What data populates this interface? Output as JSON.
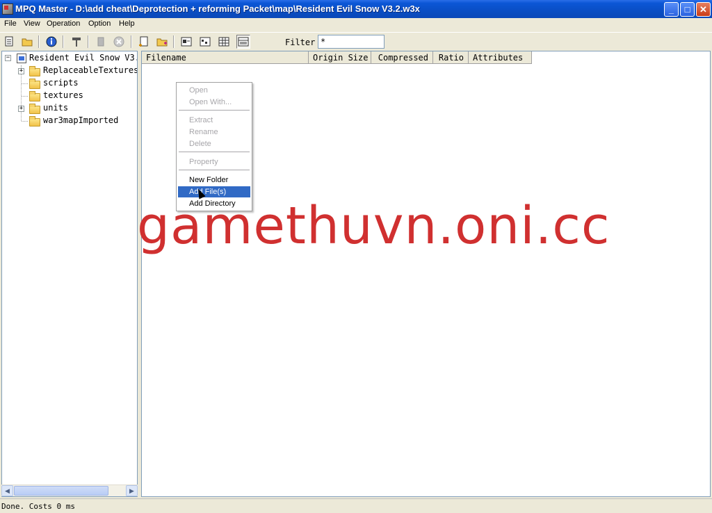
{
  "window": {
    "title": "MPQ Master - D:\\add cheat\\Deprotection + reforming Packet\\map\\Resident Evil Snow V3.2.w3x",
    "minimize": "_",
    "maximize": "□",
    "close": "✕"
  },
  "menu": [
    "File",
    "View",
    "Operation",
    "Option",
    "Help"
  ],
  "toolbar": {
    "icons": [
      "new-archive-icon",
      "open-folder-icon",
      "info-icon",
      "tools-icon",
      "stop-icon",
      "cancel-icon",
      "new-file-icon",
      "add-folder-icon",
      "view-large-icon",
      "view-small-icon",
      "view-list-icon",
      "view-details-icon"
    ],
    "filter_label": "Filter",
    "filter_value": "*"
  },
  "tree": {
    "root": "Resident Evil Snow V3.",
    "items": [
      {
        "label": "ReplaceableTextures",
        "expandable": true
      },
      {
        "label": "scripts",
        "expandable": false
      },
      {
        "label": "textures",
        "expandable": false
      },
      {
        "label": "units",
        "expandable": true
      },
      {
        "label": "war3mapImported",
        "expandable": false
      }
    ]
  },
  "list": {
    "columns": [
      "Filename",
      "Origin Size",
      "Compressed",
      "Ratio",
      "Attributes"
    ]
  },
  "context_menu": {
    "items": [
      {
        "label": "Open",
        "enabled": false
      },
      {
        "label": "Open With...",
        "enabled": false
      },
      {
        "label": "Extract",
        "enabled": false
      },
      {
        "label": "Rename",
        "enabled": false
      },
      {
        "label": "Delete",
        "enabled": false
      },
      {
        "label": "Property",
        "enabled": false
      },
      {
        "label": "New Folder",
        "enabled": true
      },
      {
        "label": "Add File(s)",
        "enabled": true,
        "selected": true
      },
      {
        "label": "Add Directory",
        "enabled": true
      }
    ]
  },
  "watermark": "gamethuvn.oni.cc",
  "status": "Done. Costs 0 ms",
  "colors": {
    "titlebar": "#0a4ec4",
    "selection": "#316ac5",
    "watermark": "#d03030"
  }
}
